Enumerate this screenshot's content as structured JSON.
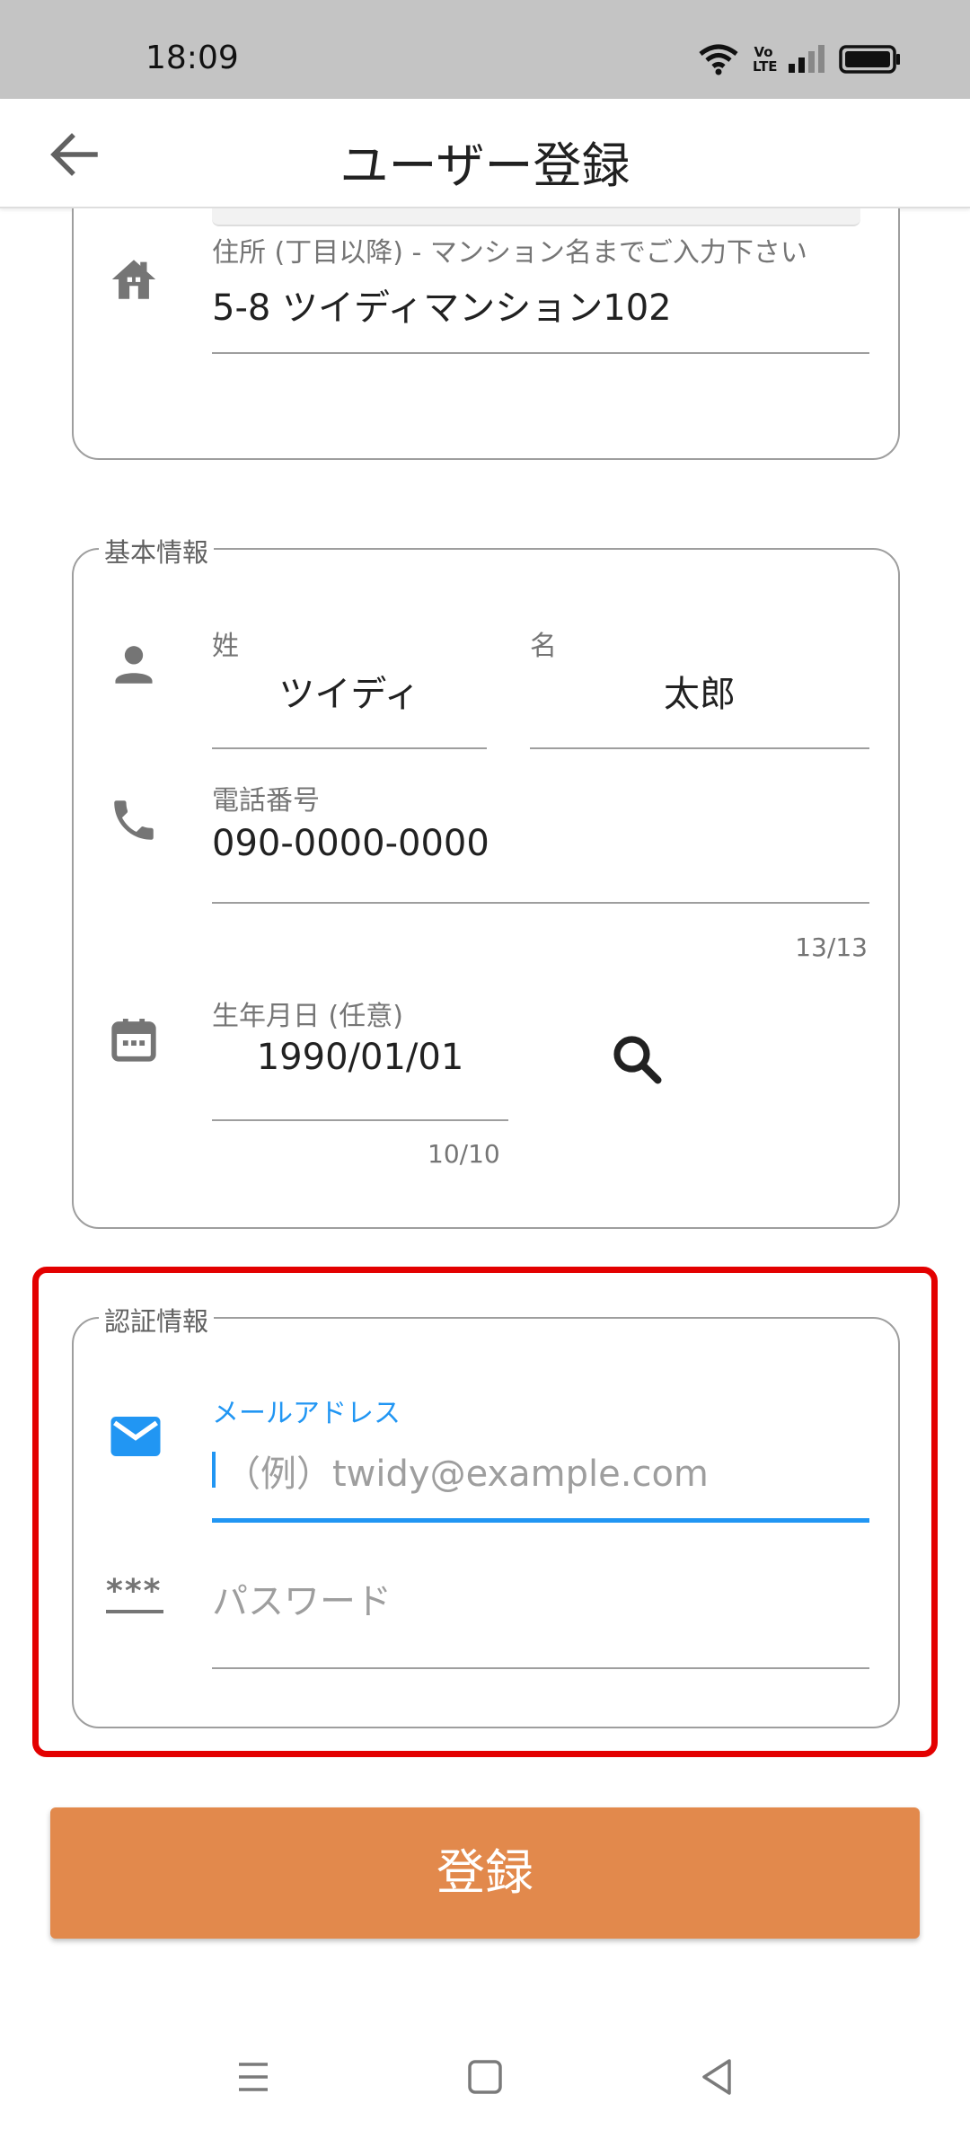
{
  "status_bar": {
    "time": "18:09",
    "volte_label": "Vo LTE"
  },
  "app_bar": {
    "title": "ユーザー登録"
  },
  "address": {
    "line2_label": "住所 (丁目以降) - マンション名までご入力下さい",
    "line2_value": "5-8 ツイディマンション102"
  },
  "basic_info": {
    "legend": "基本情報",
    "last_name_label": "姓",
    "last_name_value": "ツイディ",
    "first_name_label": "名",
    "first_name_value": "太郎",
    "phone_label": "電話番号",
    "phone_value": "090-0000-0000",
    "phone_counter": "13/13",
    "birthdate_label": "生年月日 (任意)",
    "birthdate_value": "1990/01/01",
    "birthdate_counter": "10/10"
  },
  "auth_info": {
    "legend": "認証情報",
    "email_label": "メールアドレス",
    "email_placeholder": "（例）twidy@example.com",
    "password_placeholder": "パスワード",
    "password_icon_text": "***"
  },
  "submit_button": {
    "label": "登録"
  },
  "colors": {
    "accent": "#2196f3",
    "submit": "#e2894c",
    "highlight": "#e30000"
  }
}
